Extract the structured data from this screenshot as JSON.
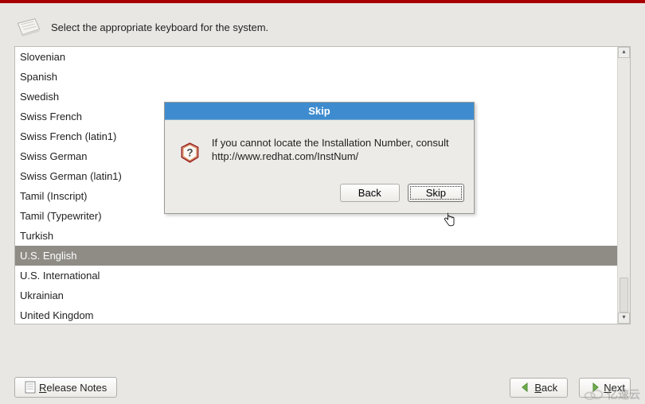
{
  "header": {
    "text": "Select the appropriate keyboard for the system."
  },
  "list": {
    "items": [
      "Slovenian",
      "Spanish",
      "Swedish",
      "Swiss French",
      "Swiss French (latin1)",
      "Swiss German",
      "Swiss German (latin1)",
      "Tamil (Inscript)",
      "Tamil (Typewriter)",
      "Turkish",
      "U.S. English",
      "U.S. International",
      "Ukrainian",
      "United Kingdom"
    ],
    "selected_index": 10
  },
  "dialog": {
    "title": "Skip",
    "message": "If you cannot locate the Installation Number, consult http://www.redhat.com/InstNum/",
    "back_label": "Back",
    "back_mnemonic": "B",
    "skip_label": "Skip",
    "skip_mnemonic": "S"
  },
  "footer": {
    "release_notes": "Release Notes",
    "release_notes_mnemonic": "R",
    "back": "Back",
    "back_mnemonic": "B",
    "next": "Next",
    "next_mnemonic": "N"
  },
  "watermark": "亿速云"
}
